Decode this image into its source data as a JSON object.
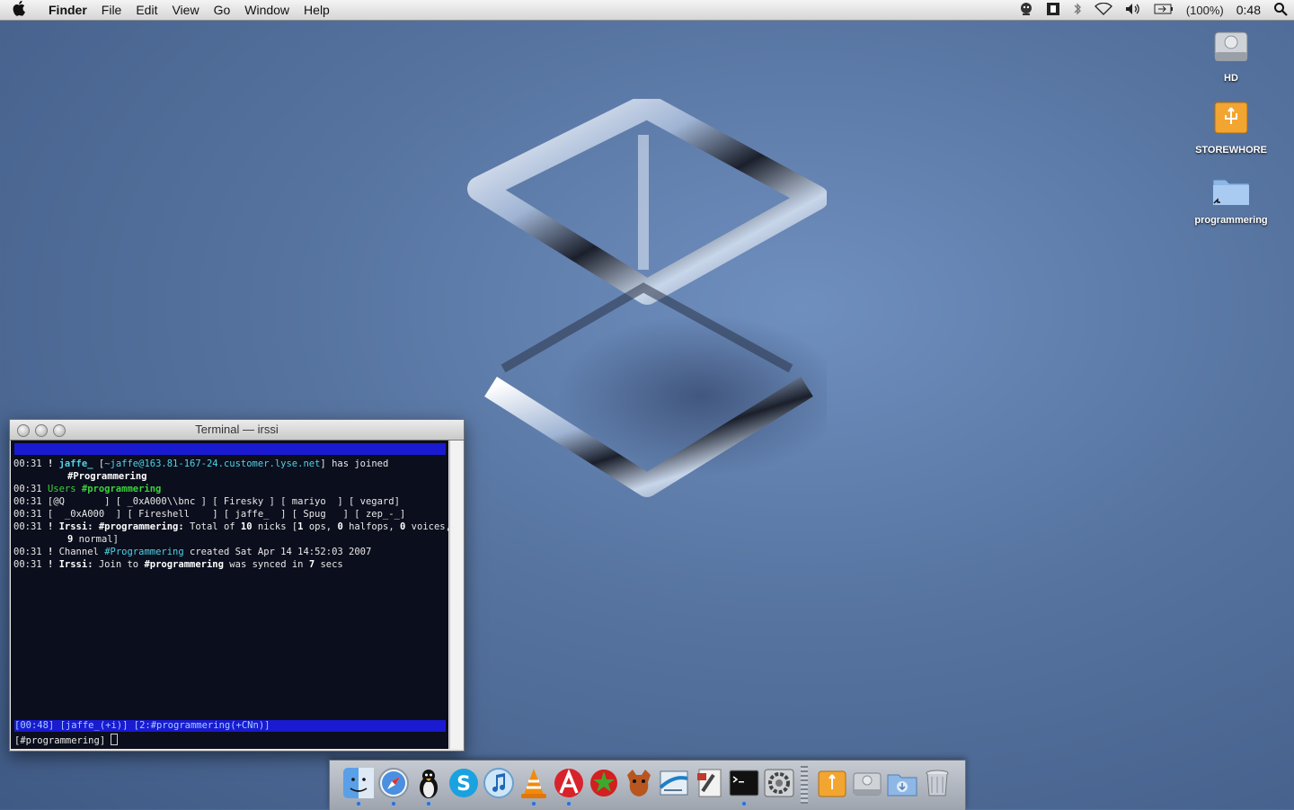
{
  "menubar": {
    "app_name": "Finder",
    "menus": [
      "File",
      "Edit",
      "View",
      "Go",
      "Window",
      "Help"
    ],
    "battery_percent": "(100%)",
    "clock": "0:48",
    "status_icons": [
      "skype-status-icon",
      "window-manager-icon",
      "bluetooth-icon",
      "wifi-icon",
      "volume-icon",
      "battery-icon",
      "spotlight-icon"
    ]
  },
  "desktop": {
    "icons": [
      {
        "label": "HD",
        "icon": "hard-drive-icon"
      },
      {
        "label": "STOREWHORE",
        "icon": "usb-drive-icon"
      },
      {
        "label": "programmering",
        "icon": "folder-alias-icon"
      }
    ]
  },
  "terminal": {
    "title": "Terminal — irssi",
    "lines": {
      "l1_time": "00:31",
      "l1_bang": "!",
      "l1_nick": "jaffe_",
      "l1_host": "~jaffe@163.81-167-24.customer.lyse.net",
      "l1_text": "has joined",
      "l2_chan": "#Programmering",
      "l3_time": "00:31",
      "l3_users": "Users",
      "l3_chan": "#programmering",
      "l4_time": "00:31",
      "l4_text": "@Q       ] [ _0xA000\\\\bnc ] [ Firesky ] [ mariyo  ] [ vegard",
      "l5_time": "00:31",
      "l5_text": "  _0xA000  ] [ Fireshell    ] [ jaffe_  ] [ Spug   ] [ zep_-_",
      "l6_time": "00:31",
      "l6_bang": "!",
      "l6_irssi": "Irssi:",
      "l6_chan": "#programmering:",
      "l6_total": "Total of",
      "l6_n1": "10",
      "l6_nicks": "nicks [",
      "l6_n2": "1",
      "l6_ops": "ops,",
      "l6_n3": "0",
      "l6_halfops": "halfops,",
      "l6_n4": "0",
      "l6_voices": "voices,",
      "l7_n": "9",
      "l7_normal": "normal]",
      "l8_time": "00:31",
      "l8_bang": "!",
      "l8_text1": "Channel",
      "l8_chan": "#Programmering",
      "l8_text2": "created Sat Apr 14 14:52:03 2007",
      "l9_time": "00:31",
      "l9_bang": "!",
      "l9_irssi": "Irssi:",
      "l9_join": "Join to",
      "l9_chan": "#programmering",
      "l9_synced": "was synced in",
      "l9_n": "7",
      "l9_secs": "secs"
    },
    "status_line": "[00:48] [jaffe_(+i)] [2:#programmering(+CNn)]",
    "prompt": "[#programmering]"
  },
  "dock": {
    "apps": [
      {
        "name": "Finder",
        "icon": "finder-icon",
        "running": true
      },
      {
        "name": "Safari",
        "icon": "safari-icon",
        "running": true
      },
      {
        "name": "Adium",
        "icon": "adium-icon",
        "running": true
      },
      {
        "name": "Skype",
        "icon": "skype-icon",
        "running": false
      },
      {
        "name": "iTunes",
        "icon": "itunes-icon",
        "running": false
      },
      {
        "name": "VLC",
        "icon": "vlc-icon",
        "running": true
      },
      {
        "name": "TextMate",
        "icon": "textmate-icon",
        "running": true
      },
      {
        "name": "Transmission",
        "icon": "transmission-icon",
        "running": false
      },
      {
        "name": "Growl",
        "icon": "growl-icon",
        "running": false
      },
      {
        "name": "NeoOffice",
        "icon": "office-icon",
        "running": false
      },
      {
        "name": "Script Editor",
        "icon": "script-editor-icon",
        "running": false
      },
      {
        "name": "Terminal",
        "icon": "terminal-icon",
        "running": true
      },
      {
        "name": "System Preferences",
        "icon": "system-preferences-icon",
        "running": false
      }
    ],
    "docklets": [
      {
        "name": "STOREWHORE",
        "icon": "usb-drive-icon"
      },
      {
        "name": "HD",
        "icon": "hard-drive-icon"
      },
      {
        "name": "Downloads",
        "icon": "downloads-folder-icon"
      },
      {
        "name": "Trash",
        "icon": "trash-icon"
      }
    ]
  }
}
